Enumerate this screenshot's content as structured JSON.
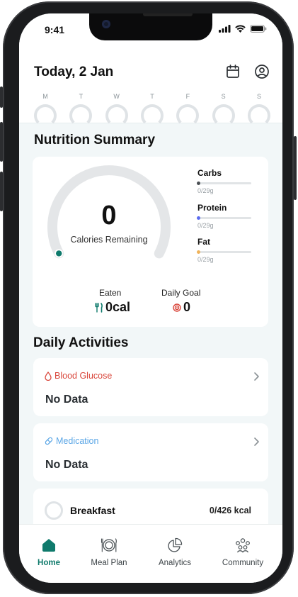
{
  "status": {
    "time": "9:41"
  },
  "header": {
    "title": "Today, 2 Jan"
  },
  "week": [
    "M",
    "T",
    "W",
    "T",
    "F",
    "S",
    "S"
  ],
  "nutrition": {
    "title": "Nutrition Summary",
    "calories_value": "0",
    "calories_label": "Calories Remaining",
    "macros": [
      {
        "name": "Carbs",
        "value": "0/29g",
        "color": "#4a4f53",
        "progress": 0
      },
      {
        "name": "Protein",
        "value": "0/29g",
        "color": "#5b6bf0",
        "progress": 0
      },
      {
        "name": "Fat",
        "value": "0/29g",
        "color": "#f0b35a",
        "progress": 0
      }
    ],
    "eaten_label": "Eaten",
    "eaten_value": "0cal",
    "goal_label": "Daily Goal",
    "goal_value": "0"
  },
  "activities": {
    "title": "Daily Activities",
    "blood_glucose": {
      "label": "Blood Glucose",
      "value": "No Data",
      "color": "#d9463b"
    },
    "medication": {
      "label": "Medication",
      "value": "No Data",
      "color": "#5aa6e6"
    },
    "breakfast": {
      "label": "Breakfast",
      "value": "0/426 kcal"
    }
  },
  "tabs": [
    {
      "label": "Home",
      "icon": "home-icon",
      "active": true
    },
    {
      "label": "Meal Plan",
      "icon": "plate-icon",
      "active": false
    },
    {
      "label": "Analytics",
      "icon": "pie-chart-icon",
      "active": false
    },
    {
      "label": "Community",
      "icon": "community-icon",
      "active": false
    }
  ],
  "colors": {
    "accent": "#0f7a6c",
    "ring": "#e4e6e8"
  }
}
